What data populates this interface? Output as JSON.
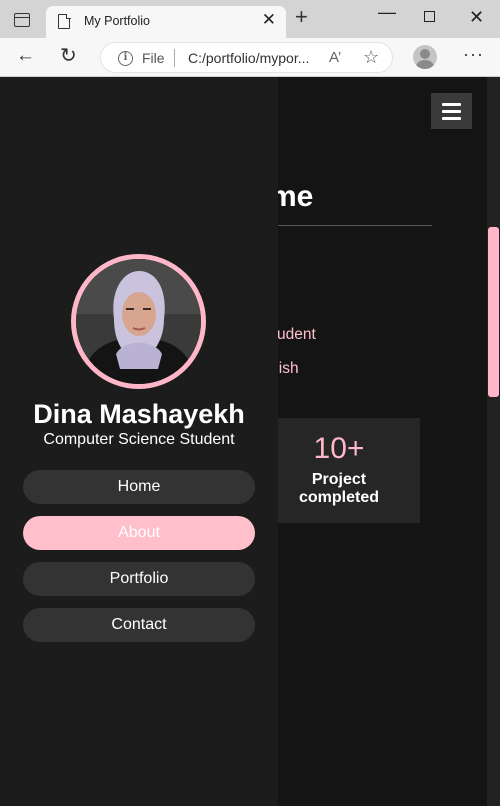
{
  "browser": {
    "tab_title": "My Portfolio",
    "tab_close": "✕",
    "new_tab": "+",
    "window_min": "—",
    "window_close": "✕",
    "address_scheme": "File",
    "address_url": "C:/portfolio/mypor...",
    "read_aloud": "A’",
    "favorite": "☆",
    "more": "···",
    "back": "←",
    "reload": "↻",
    "info": "i"
  },
  "main": {
    "section_title": "Home",
    "section_title_visible": "me",
    "about_line1": "ing student",
    "about_line2": "Swedish",
    "stat": {
      "number": "10+",
      "label_line1": "Project",
      "label_line2": "completed"
    }
  },
  "sidebar": {
    "name": "Dina Mashayekh",
    "role": "Computer Science Student",
    "nav": [
      {
        "label": "Home",
        "active": false
      },
      {
        "label": "About",
        "active": true
      },
      {
        "label": "Portfolio",
        "active": false
      },
      {
        "label": "Contact",
        "active": false
      }
    ]
  },
  "colors": {
    "accent": "#ffc0cb",
    "background": "#111111",
    "sidebar": "#1c1c1c",
    "button": "#333333"
  }
}
